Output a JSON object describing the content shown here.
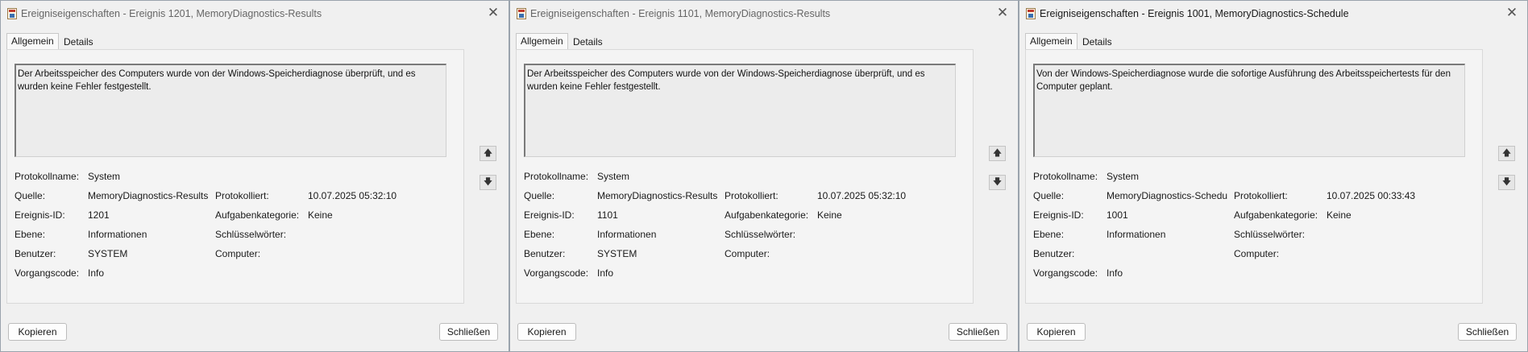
{
  "windows": [
    {
      "title": "Ereigniseigenschaften - Ereignis 1201, MemoryDiagnostics-Results",
      "tabs": [
        "Allgemein",
        "Details"
      ],
      "message": "Der Arbeitsspeicher des Computers wurde von der Windows-Speicherdiagnose überprüft, und es wurden keine Fehler festgestellt.",
      "labels": {
        "protokollname": "Protokollname:",
        "quelle": "Quelle:",
        "ereignis_id": "Ereignis-ID:",
        "ebene": "Ebene:",
        "benutzer": "Benutzer:",
        "vorgangscode": "Vorgangscode:",
        "protokolliert": "Protokolliert:",
        "aufgabenkategorie": "Aufgabenkategorie:",
        "schluesselwoerter": "Schlüsselwörter:",
        "computer": "Computer:"
      },
      "values": {
        "protokollname": "System",
        "quelle": "MemoryDiagnostics-Results",
        "ereignis_id": "1201",
        "ebene": "Informationen",
        "benutzer": "SYSTEM",
        "vorgangscode": "Info",
        "protokolliert": "10.07.2025 05:32:10",
        "aufgabenkategorie": "Keine",
        "schluesselwoerter": "",
        "computer": ""
      },
      "buttons": {
        "copy": "Kopieren",
        "close": "Schließen"
      },
      "close_glyph": "✕"
    },
    {
      "title": "Ereigniseigenschaften - Ereignis 1101, MemoryDiagnostics-Results",
      "tabs": [
        "Allgemein",
        "Details"
      ],
      "message": "Der Arbeitsspeicher des Computers wurde von der Windows-Speicherdiagnose überprüft, und es wurden keine Fehler festgestellt.",
      "labels": {
        "protokollname": "Protokollname:",
        "quelle": "Quelle:",
        "ereignis_id": "Ereignis-ID:",
        "ebene": "Ebene:",
        "benutzer": "Benutzer:",
        "vorgangscode": "Vorgangscode:",
        "protokolliert": "Protokolliert:",
        "aufgabenkategorie": "Aufgabenkategorie:",
        "schluesselwoerter": "Schlüsselwörter:",
        "computer": "Computer:"
      },
      "values": {
        "protokollname": "System",
        "quelle": "MemoryDiagnostics-Results",
        "ereignis_id": "1101",
        "ebene": "Informationen",
        "benutzer": "SYSTEM",
        "vorgangscode": "Info",
        "protokolliert": "10.07.2025 05:32:10",
        "aufgabenkategorie": "Keine",
        "schluesselwoerter": "",
        "computer": ""
      },
      "buttons": {
        "copy": "Kopieren",
        "close": "Schließen"
      },
      "close_glyph": "✕"
    },
    {
      "title": "Ereigniseigenschaften - Ereignis 1001, MemoryDiagnostics-Schedule",
      "tabs": [
        "Allgemein",
        "Details"
      ],
      "message": "Von der Windows-Speicherdiagnose wurde die sofortige Ausführung des Arbeitsspeichertests für den Computer geplant.",
      "labels": {
        "protokollname": "Protokollname:",
        "quelle": "Quelle:",
        "ereignis_id": "Ereignis-ID:",
        "ebene": "Ebene:",
        "benutzer": "Benutzer:",
        "vorgangscode": "Vorgangscode:",
        "protokolliert": "Protokolliert:",
        "aufgabenkategorie": "Aufgabenkategorie:",
        "schluesselwoerter": "Schlüsselwörter:",
        "computer": "Computer:"
      },
      "values": {
        "protokollname": "System",
        "quelle": "MemoryDiagnostics-Schedu",
        "ereignis_id": "1001",
        "ebene": "Informationen",
        "benutzer": "",
        "vorgangscode": "Info",
        "protokolliert": "10.07.2025 00:33:43",
        "aufgabenkategorie": "Keine",
        "schluesselwoerter": "",
        "computer": ""
      },
      "buttons": {
        "copy": "Kopieren",
        "close": "Schließen"
      },
      "close_glyph": "✕"
    }
  ],
  "icons": {
    "scroll_up": "arrow-up-icon",
    "scroll_down": "arrow-down-icon",
    "up_glyph": "🡅",
    "down_glyph": "🡇"
  }
}
